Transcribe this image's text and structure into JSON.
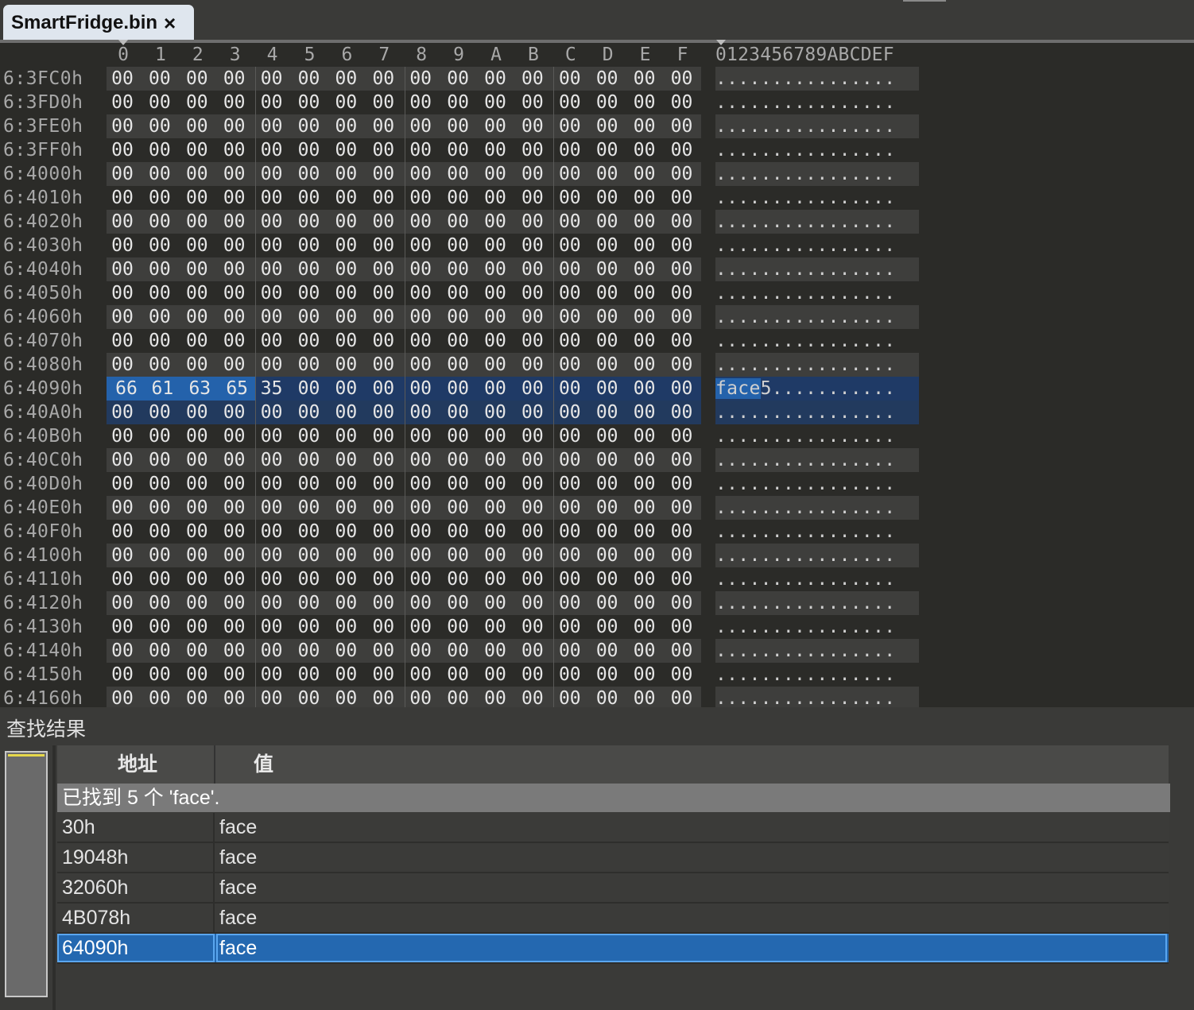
{
  "tab": {
    "title": "SmartFridge.bin",
    "close_glyph": "×"
  },
  "hex": {
    "column_headers": [
      "0",
      "1",
      "2",
      "3",
      "4",
      "5",
      "6",
      "7",
      "8",
      "9",
      "A",
      "B",
      "C",
      "D",
      "E",
      "F"
    ],
    "ascii_header": "0123456789ABCDEF",
    "rows": [
      {
        "addr": "6:3FC0h",
        "bytes": [
          "00",
          "00",
          "00",
          "00",
          "00",
          "00",
          "00",
          "00",
          "00",
          "00",
          "00",
          "00",
          "00",
          "00",
          "00",
          "00"
        ],
        "ascii": "................"
      },
      {
        "addr": "6:3FD0h",
        "bytes": [
          "00",
          "00",
          "00",
          "00",
          "00",
          "00",
          "00",
          "00",
          "00",
          "00",
          "00",
          "00",
          "00",
          "00",
          "00",
          "00"
        ],
        "ascii": "................"
      },
      {
        "addr": "6:3FE0h",
        "bytes": [
          "00",
          "00",
          "00",
          "00",
          "00",
          "00",
          "00",
          "00",
          "00",
          "00",
          "00",
          "00",
          "00",
          "00",
          "00",
          "00"
        ],
        "ascii": "................"
      },
      {
        "addr": "6:3FF0h",
        "bytes": [
          "00",
          "00",
          "00",
          "00",
          "00",
          "00",
          "00",
          "00",
          "00",
          "00",
          "00",
          "00",
          "00",
          "00",
          "00",
          "00"
        ],
        "ascii": "................"
      },
      {
        "addr": "6:4000h",
        "bytes": [
          "00",
          "00",
          "00",
          "00",
          "00",
          "00",
          "00",
          "00",
          "00",
          "00",
          "00",
          "00",
          "00",
          "00",
          "00",
          "00"
        ],
        "ascii": "................"
      },
      {
        "addr": "6:4010h",
        "bytes": [
          "00",
          "00",
          "00",
          "00",
          "00",
          "00",
          "00",
          "00",
          "00",
          "00",
          "00",
          "00",
          "00",
          "00",
          "00",
          "00"
        ],
        "ascii": "................"
      },
      {
        "addr": "6:4020h",
        "bytes": [
          "00",
          "00",
          "00",
          "00",
          "00",
          "00",
          "00",
          "00",
          "00",
          "00",
          "00",
          "00",
          "00",
          "00",
          "00",
          "00"
        ],
        "ascii": "................"
      },
      {
        "addr": "6:4030h",
        "bytes": [
          "00",
          "00",
          "00",
          "00",
          "00",
          "00",
          "00",
          "00",
          "00",
          "00",
          "00",
          "00",
          "00",
          "00",
          "00",
          "00"
        ],
        "ascii": "................"
      },
      {
        "addr": "6:4040h",
        "bytes": [
          "00",
          "00",
          "00",
          "00",
          "00",
          "00",
          "00",
          "00",
          "00",
          "00",
          "00",
          "00",
          "00",
          "00",
          "00",
          "00"
        ],
        "ascii": "................"
      },
      {
        "addr": "6:4050h",
        "bytes": [
          "00",
          "00",
          "00",
          "00",
          "00",
          "00",
          "00",
          "00",
          "00",
          "00",
          "00",
          "00",
          "00",
          "00",
          "00",
          "00"
        ],
        "ascii": "................"
      },
      {
        "addr": "6:4060h",
        "bytes": [
          "00",
          "00",
          "00",
          "00",
          "00",
          "00",
          "00",
          "00",
          "00",
          "00",
          "00",
          "00",
          "00",
          "00",
          "00",
          "00"
        ],
        "ascii": "................"
      },
      {
        "addr": "6:4070h",
        "bytes": [
          "00",
          "00",
          "00",
          "00",
          "00",
          "00",
          "00",
          "00",
          "00",
          "00",
          "00",
          "00",
          "00",
          "00",
          "00",
          "00"
        ],
        "ascii": "................"
      },
      {
        "addr": "6:4080h",
        "bytes": [
          "00",
          "00",
          "00",
          "00",
          "00",
          "00",
          "00",
          "00",
          "00",
          "00",
          "00",
          "00",
          "00",
          "00",
          "00",
          "00"
        ],
        "ascii": "................"
      },
      {
        "addr": "6:4090h",
        "bytes": [
          "66",
          "61",
          "63",
          "65",
          "35",
          "00",
          "00",
          "00",
          "00",
          "00",
          "00",
          "00",
          "00",
          "00",
          "00",
          "00"
        ],
        "ascii": "face5...........",
        "highlight_count": 4,
        "selected": true
      },
      {
        "addr": "6:40A0h",
        "bytes": [
          "00",
          "00",
          "00",
          "00",
          "00",
          "00",
          "00",
          "00",
          "00",
          "00",
          "00",
          "00",
          "00",
          "00",
          "00",
          "00"
        ],
        "ascii": "................",
        "selected2": true
      },
      {
        "addr": "6:40B0h",
        "bytes": [
          "00",
          "00",
          "00",
          "00",
          "00",
          "00",
          "00",
          "00",
          "00",
          "00",
          "00",
          "00",
          "00",
          "00",
          "00",
          "00"
        ],
        "ascii": "................"
      },
      {
        "addr": "6:40C0h",
        "bytes": [
          "00",
          "00",
          "00",
          "00",
          "00",
          "00",
          "00",
          "00",
          "00",
          "00",
          "00",
          "00",
          "00",
          "00",
          "00",
          "00"
        ],
        "ascii": "................"
      },
      {
        "addr": "6:40D0h",
        "bytes": [
          "00",
          "00",
          "00",
          "00",
          "00",
          "00",
          "00",
          "00",
          "00",
          "00",
          "00",
          "00",
          "00",
          "00",
          "00",
          "00"
        ],
        "ascii": "................"
      },
      {
        "addr": "6:40E0h",
        "bytes": [
          "00",
          "00",
          "00",
          "00",
          "00",
          "00",
          "00",
          "00",
          "00",
          "00",
          "00",
          "00",
          "00",
          "00",
          "00",
          "00"
        ],
        "ascii": "................"
      },
      {
        "addr": "6:40F0h",
        "bytes": [
          "00",
          "00",
          "00",
          "00",
          "00",
          "00",
          "00",
          "00",
          "00",
          "00",
          "00",
          "00",
          "00",
          "00",
          "00",
          "00"
        ],
        "ascii": "................"
      },
      {
        "addr": "6:4100h",
        "bytes": [
          "00",
          "00",
          "00",
          "00",
          "00",
          "00",
          "00",
          "00",
          "00",
          "00",
          "00",
          "00",
          "00",
          "00",
          "00",
          "00"
        ],
        "ascii": "................"
      },
      {
        "addr": "6:4110h",
        "bytes": [
          "00",
          "00",
          "00",
          "00",
          "00",
          "00",
          "00",
          "00",
          "00",
          "00",
          "00",
          "00",
          "00",
          "00",
          "00",
          "00"
        ],
        "ascii": "................"
      },
      {
        "addr": "6:4120h",
        "bytes": [
          "00",
          "00",
          "00",
          "00",
          "00",
          "00",
          "00",
          "00",
          "00",
          "00",
          "00",
          "00",
          "00",
          "00",
          "00",
          "00"
        ],
        "ascii": "................"
      },
      {
        "addr": "6:4130h",
        "bytes": [
          "00",
          "00",
          "00",
          "00",
          "00",
          "00",
          "00",
          "00",
          "00",
          "00",
          "00",
          "00",
          "00",
          "00",
          "00",
          "00"
        ],
        "ascii": "................"
      },
      {
        "addr": "6:4140h",
        "bytes": [
          "00",
          "00",
          "00",
          "00",
          "00",
          "00",
          "00",
          "00",
          "00",
          "00",
          "00",
          "00",
          "00",
          "00",
          "00",
          "00"
        ],
        "ascii": "................"
      },
      {
        "addr": "6:4150h",
        "bytes": [
          "00",
          "00",
          "00",
          "00",
          "00",
          "00",
          "00",
          "00",
          "00",
          "00",
          "00",
          "00",
          "00",
          "00",
          "00",
          "00"
        ],
        "ascii": "................"
      },
      {
        "addr": "6:4160h",
        "bytes": [
          "00",
          "00",
          "00",
          "00",
          "00",
          "00",
          "00",
          "00",
          "00",
          "00",
          "00",
          "00",
          "00",
          "00",
          "00",
          "00"
        ],
        "ascii": "................"
      }
    ]
  },
  "results": {
    "title": "查找结果",
    "col_address": "地址",
    "col_value": "值",
    "summary": "已找到 5 个 'face'.",
    "rows": [
      {
        "address": "30h",
        "value": "face"
      },
      {
        "address": "19048h",
        "value": "face"
      },
      {
        "address": "32060h",
        "value": "face"
      },
      {
        "address": "4B078h",
        "value": "face"
      },
      {
        "address": "64090h",
        "value": "face",
        "selected": true
      }
    ]
  },
  "colors": {
    "selection": "#2462ab",
    "selected_row": "#2468b0",
    "background": "#2b2b28"
  }
}
